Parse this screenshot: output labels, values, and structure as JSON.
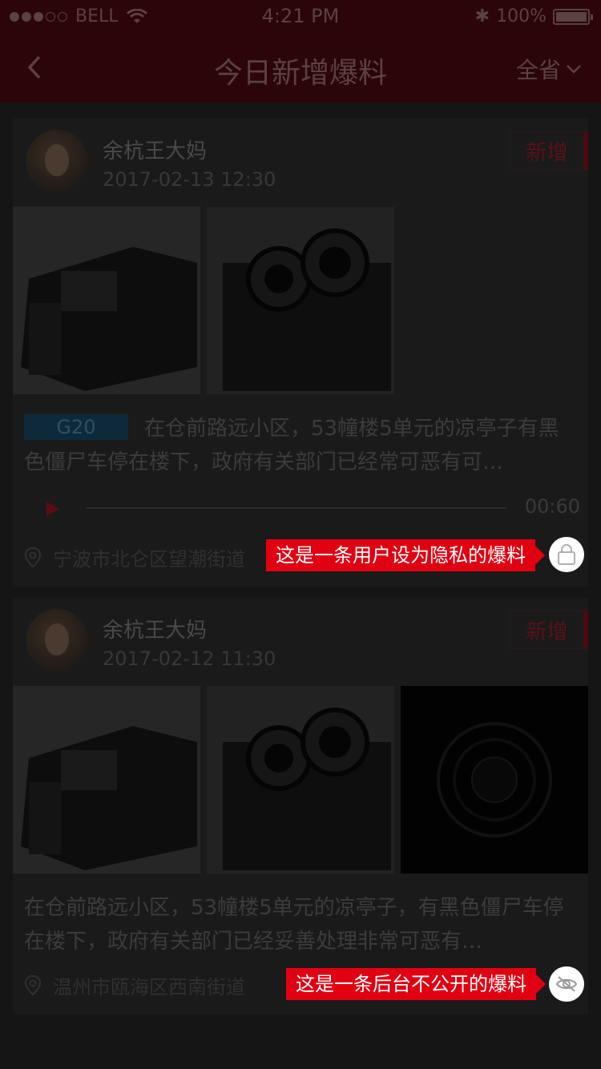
{
  "status_bar": {
    "carrier": "BELL",
    "time": "4:21 PM",
    "battery": "100%"
  },
  "nav": {
    "title": "今日新增爆料",
    "region": "全省"
  },
  "posts": [
    {
      "username": "余杭王大妈",
      "datetime": "2017-02-13  12:30",
      "badge": "新增",
      "tag": "G20",
      "description": "在仓前路远小区，53幢楼5单元的凉亭子有黑色僵尸车停在楼下，政府有关部门已经常可恶有可…",
      "audio_duration": "00:60",
      "location": "宁波市北仑区望潮街道",
      "tooltip": "这是一条用户设为隐私的爆料",
      "icon": "lock-icon"
    },
    {
      "username": "余杭王大妈",
      "datetime": "2017-02-12  11:30",
      "badge": "新增",
      "description": "在仓前路远小区，53幢楼5单元的凉亭子，有黑色僵尸车停在楼下，政府有关部门已经妥善处理非常可恶有…",
      "location": "温州市瓯海区西南街道",
      "tooltip": "这是一条后台不公开的爆料",
      "icon": "eye-off-icon"
    }
  ],
  "colors": {
    "accent": "#e00012",
    "navbar_bg": "#2b0508",
    "overlay_bg": "#151515"
  }
}
